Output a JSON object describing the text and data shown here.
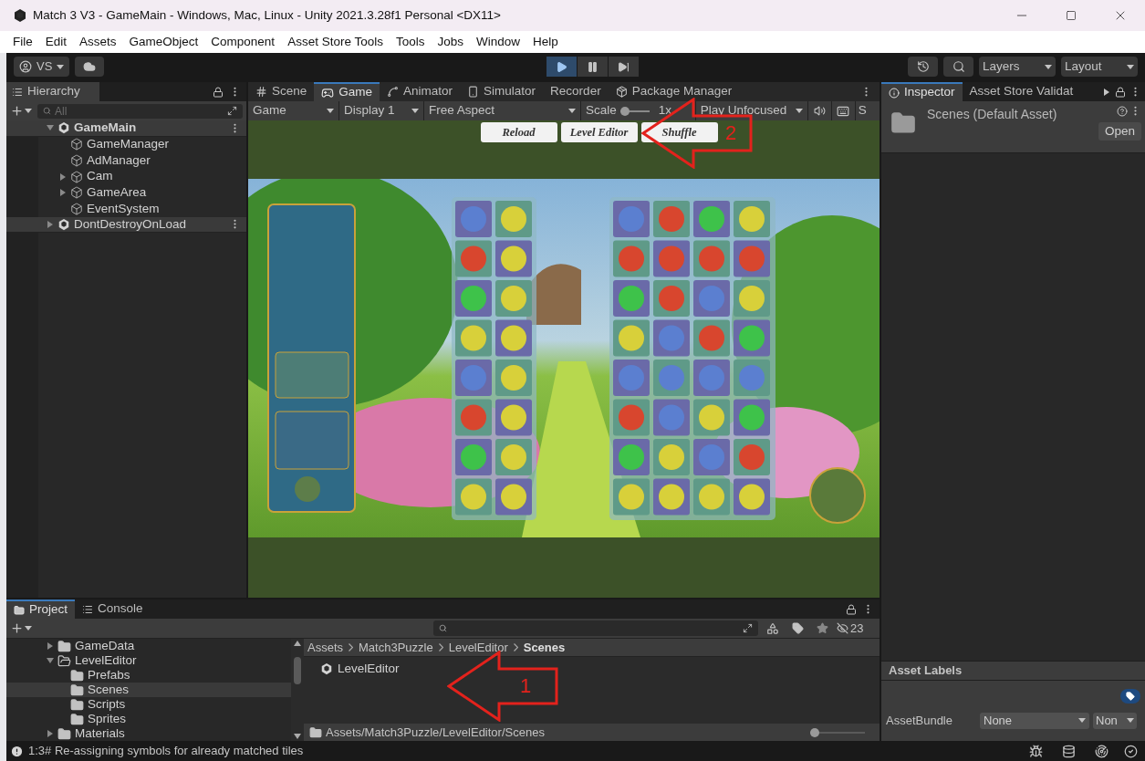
{
  "window": {
    "title": "Match 3 V3 - GameMain - Windows, Mac, Linux - Unity 2021.3.28f1 Personal <DX11>"
  },
  "menu": [
    "File",
    "Edit",
    "Assets",
    "GameObject",
    "Component",
    "Asset Store Tools",
    "Tools",
    "Jobs",
    "Window",
    "Help"
  ],
  "toolbar": {
    "account": "VS",
    "playmode": [
      {
        "kind": "play",
        "selected": true
      },
      {
        "kind": "pause",
        "selected": false
      },
      {
        "kind": "step",
        "selected": false
      }
    ],
    "layers": "Layers",
    "layout": "Layout"
  },
  "hierarchy": {
    "tab": "Hierarchy",
    "search_placeholder": "All",
    "items": [
      {
        "label": "GameMain",
        "kind": "scene",
        "expanded": true,
        "children": [
          {
            "label": "GameManager",
            "kind": "object"
          },
          {
            "label": "AdManager",
            "kind": "object"
          },
          {
            "label": "Cam",
            "kind": "object",
            "expanded": false
          },
          {
            "label": "GameArea",
            "kind": "object",
            "expanded": false
          },
          {
            "label": "EventSystem",
            "kind": "object"
          }
        ]
      },
      {
        "label": "DontDestroyOnLoad",
        "kind": "scene",
        "expanded": false
      }
    ]
  },
  "game": {
    "tabs": [
      {
        "label": "Scene",
        "selected": false
      },
      {
        "label": "Game",
        "selected": true
      },
      {
        "label": "Animator",
        "selected": false
      },
      {
        "label": "Simulator",
        "selected": false
      },
      {
        "label": "Recorder",
        "selected": false
      },
      {
        "label": "Package Manager",
        "selected": false
      }
    ],
    "view_menu": "Game",
    "display": "Display 1",
    "aspect": "Free Aspect",
    "scale_label": "Scale",
    "scale": {
      "level": 0,
      "reading": "1x"
    },
    "play_mode": "Play Unfocused",
    "cut_label": "S",
    "buttons": [
      "Reload",
      "Level Editor",
      "Shuffle"
    ]
  },
  "inspector": {
    "tabs": [
      {
        "label": "Inspector",
        "selected": true
      },
      {
        "label": "Asset Store Validat",
        "selected": false
      }
    ],
    "title": "Scenes (Default Asset)",
    "open_button": "Open",
    "labels_heading": "Asset Labels",
    "asset_bundle": {
      "label": "AssetBundle",
      "value": "None",
      "variant": "Non"
    }
  },
  "project": {
    "tabs": [
      {
        "label": "Project",
        "selected": true
      },
      {
        "label": "Console",
        "selected": false
      }
    ],
    "tree": [
      {
        "label": "GameData",
        "expanded": false,
        "selected": false
      },
      {
        "label": "LevelEditor",
        "expanded": true,
        "selected": false,
        "children": [
          {
            "label": "Prefabs",
            "selected": false
          },
          {
            "label": "Scenes",
            "selected": true
          },
          {
            "label": "Scripts",
            "selected": false
          },
          {
            "label": "Sprites",
            "selected": false
          }
        ]
      },
      {
        "label": "Materials",
        "expanded": false,
        "selected": false
      }
    ],
    "breadcrumb": [
      "Assets",
      "Match3Puzzle",
      "LevelEditor",
      "Scenes"
    ],
    "items": [
      "LevelEditor"
    ],
    "path": "Assets/Match3Puzzle/LevelEditor/Scenes",
    "hidden_count": "23",
    "zoom": {
      "level": 0
    }
  },
  "status": {
    "message": "1:3# Re-assigning symbols for already matched tiles"
  },
  "annotations": [
    {
      "label": "2"
    },
    {
      "label": "1"
    }
  ]
}
